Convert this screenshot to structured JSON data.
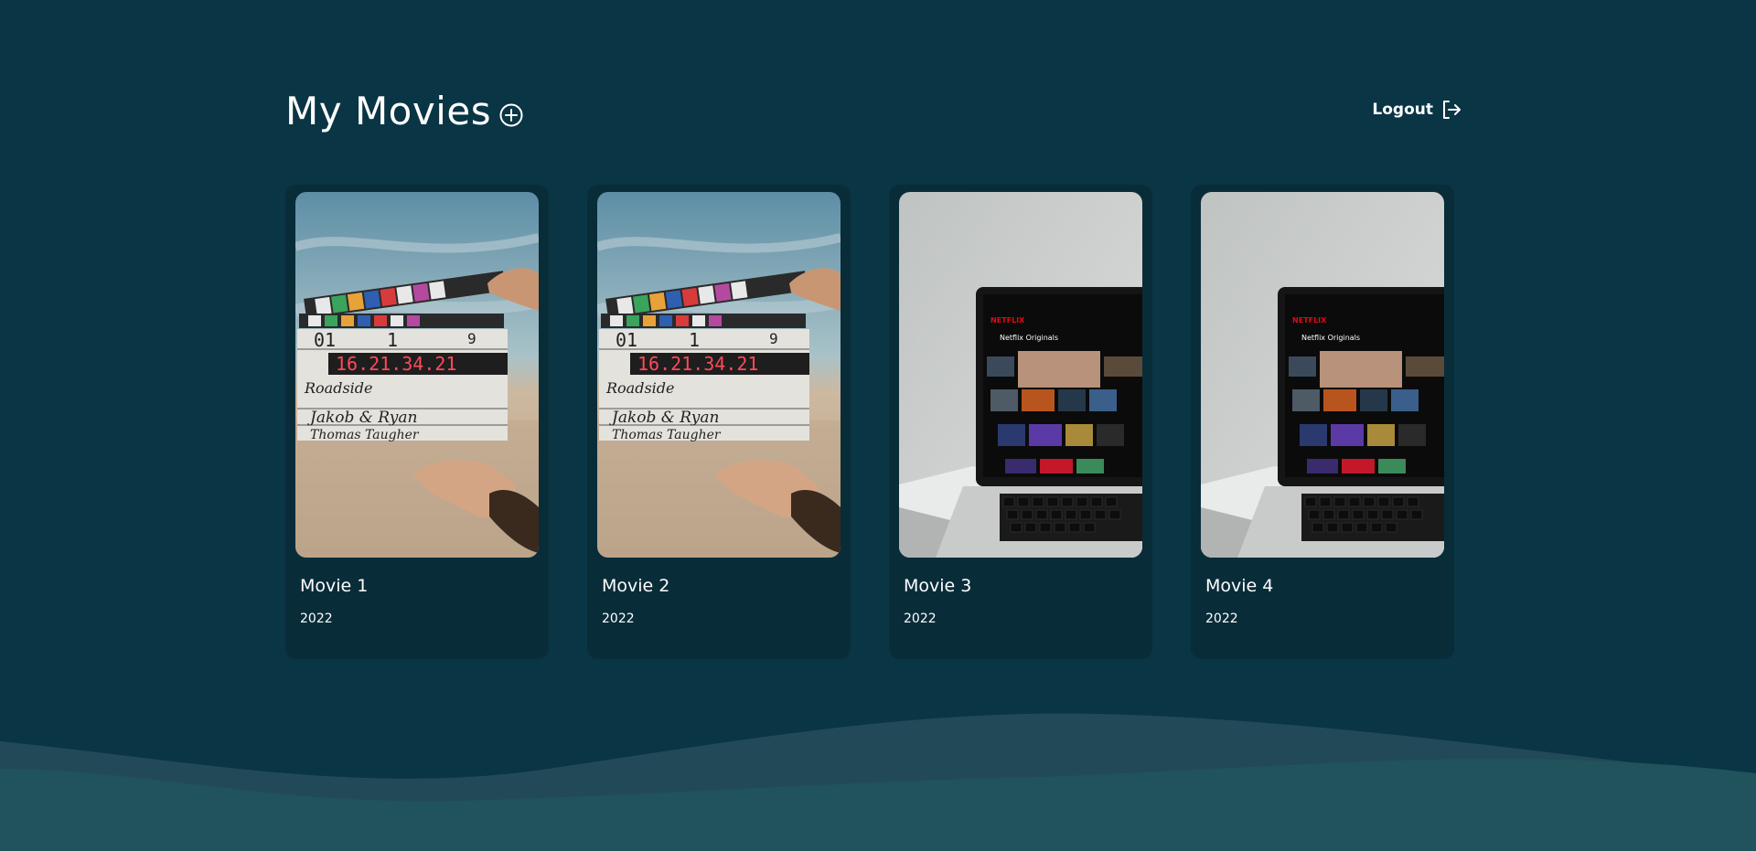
{
  "header": {
    "title": "My Movies",
    "add_icon": "plus-circle-icon",
    "logout_label": "Logout",
    "logout_icon": "logout-arrow-icon"
  },
  "movies": [
    {
      "title": "Movie 1",
      "year": "2022",
      "poster": "clapperboard"
    },
    {
      "title": "Movie 2",
      "year": "2022",
      "poster": "clapperboard"
    },
    {
      "title": "Movie 3",
      "year": "2022",
      "poster": "laptop-netflix"
    },
    {
      "title": "Movie 4",
      "year": "2022",
      "poster": "laptop-netflix"
    }
  ],
  "poster_art": {
    "slate_scene": "01",
    "slate_take": "1",
    "slate_roll": "9",
    "slate_timecode": "16.21.34.21",
    "slate_line1": "Roadside",
    "slate_line2": "Jakob & Ryan",
    "slate_line3": "Thomas Taugher",
    "screen_brand": "NETFLIX",
    "screen_heading": "Netflix Originals"
  },
  "colors": {
    "background": "#093545",
    "card": "#092c39",
    "wave_back": "#224957",
    "wave_front": "#20535c",
    "text": "#ffffff"
  }
}
